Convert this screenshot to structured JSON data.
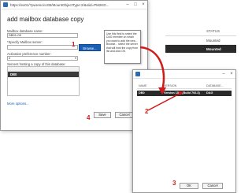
{
  "background": {
    "columns": [
      "",
      "STATUS"
    ],
    "rows": [
      {
        "c1": "",
        "c2": "Mounted",
        "selected": false
      },
      {
        "c1": "",
        "c2": "Mounted",
        "selected": true
      }
    ]
  },
  "dialog1": {
    "window_title": "https://ex01/?pwrencin.EB/MountObjectType:2/&siid=PM2KD...",
    "heading": "add mailbox database copy",
    "db_name_label": "Mailbox database name:",
    "db_name_value": "DB01-09",
    "server_label": "*Specify Mailbox server:",
    "server_value": "",
    "browse_label": "Browse...",
    "activation_label": "Activation preference number:",
    "activation_value": "2",
    "servers_label": "Servers hosting a copy of this database:",
    "servers_list": [
      "DB0"
    ],
    "more_options": "More options...",
    "save_label": "Save",
    "cancel_label": "Cancel",
    "tooltip": "Use this field to select the DAG member on which you want to add the new... Browse... select the server that will host the copy from list and click OK."
  },
  "dialog2": {
    "columns": [
      "NAME",
      "VERSION",
      "DATABASE..."
    ],
    "rows": [
      {
        "name": "DB0",
        "version": "Version 15.2 (Build 792.3)",
        "database": "DAG"
      }
    ],
    "ok_label": "OK",
    "cancel_label": "Cancel"
  },
  "annotations": {
    "n1": "1",
    "n2": "2",
    "n3": "3",
    "n4": "4"
  },
  "colors": {
    "accent": "#1a5fb4",
    "annotation": "#d11a1a",
    "selected_row": "#2a2a2a"
  }
}
